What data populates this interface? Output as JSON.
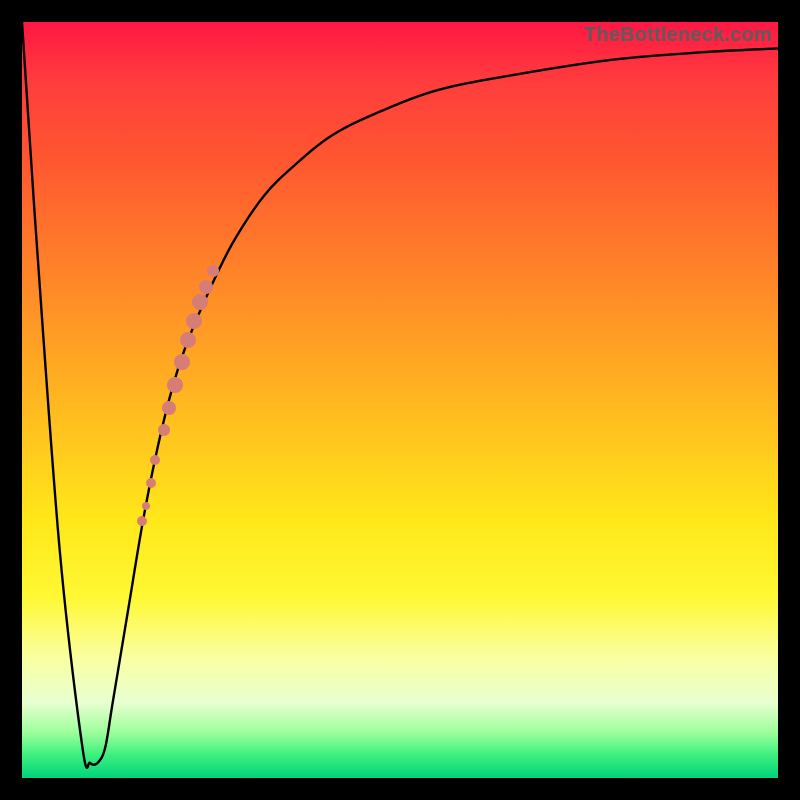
{
  "watermark": "TheBottleneck.com",
  "colors": {
    "curve": "#000000",
    "marker": "#d67d76",
    "frame": "#000000"
  },
  "chart_data": {
    "type": "line",
    "title": "",
    "xlabel": "",
    "ylabel": "",
    "xlim": [
      0,
      100
    ],
    "ylim": [
      0,
      100
    ],
    "series": [
      {
        "name": "bottleneck-curve",
        "x": [
          0,
          2,
          5,
          8,
          9,
          10,
          11,
          12,
          14,
          16,
          18,
          20,
          22,
          25,
          28,
          32,
          36,
          41,
          47,
          55,
          65,
          78,
          90,
          100
        ],
        "y": [
          100,
          70,
          30,
          4,
          2,
          2,
          4,
          10,
          22,
          34,
          44,
          52,
          58,
          65,
          71,
          77,
          81,
          85,
          88,
          91,
          93,
          95,
          96,
          96.5
        ]
      }
    ],
    "markers": [
      {
        "x": 15.9,
        "y": 34,
        "r": 5
      },
      {
        "x": 16.4,
        "y": 36,
        "r": 4
      },
      {
        "x": 17.0,
        "y": 39,
        "r": 5
      },
      {
        "x": 17.6,
        "y": 42,
        "r": 5
      },
      {
        "x": 18.8,
        "y": 46,
        "r": 6
      },
      {
        "x": 19.5,
        "y": 49,
        "r": 7
      },
      {
        "x": 20.3,
        "y": 52,
        "r": 8
      },
      {
        "x": 21.1,
        "y": 55,
        "r": 8
      },
      {
        "x": 21.9,
        "y": 58,
        "r": 8
      },
      {
        "x": 22.7,
        "y": 60.5,
        "r": 8
      },
      {
        "x": 23.5,
        "y": 63,
        "r": 8
      },
      {
        "x": 24.4,
        "y": 65,
        "r": 7
      },
      {
        "x": 25.2,
        "y": 67,
        "r": 6
      }
    ]
  }
}
